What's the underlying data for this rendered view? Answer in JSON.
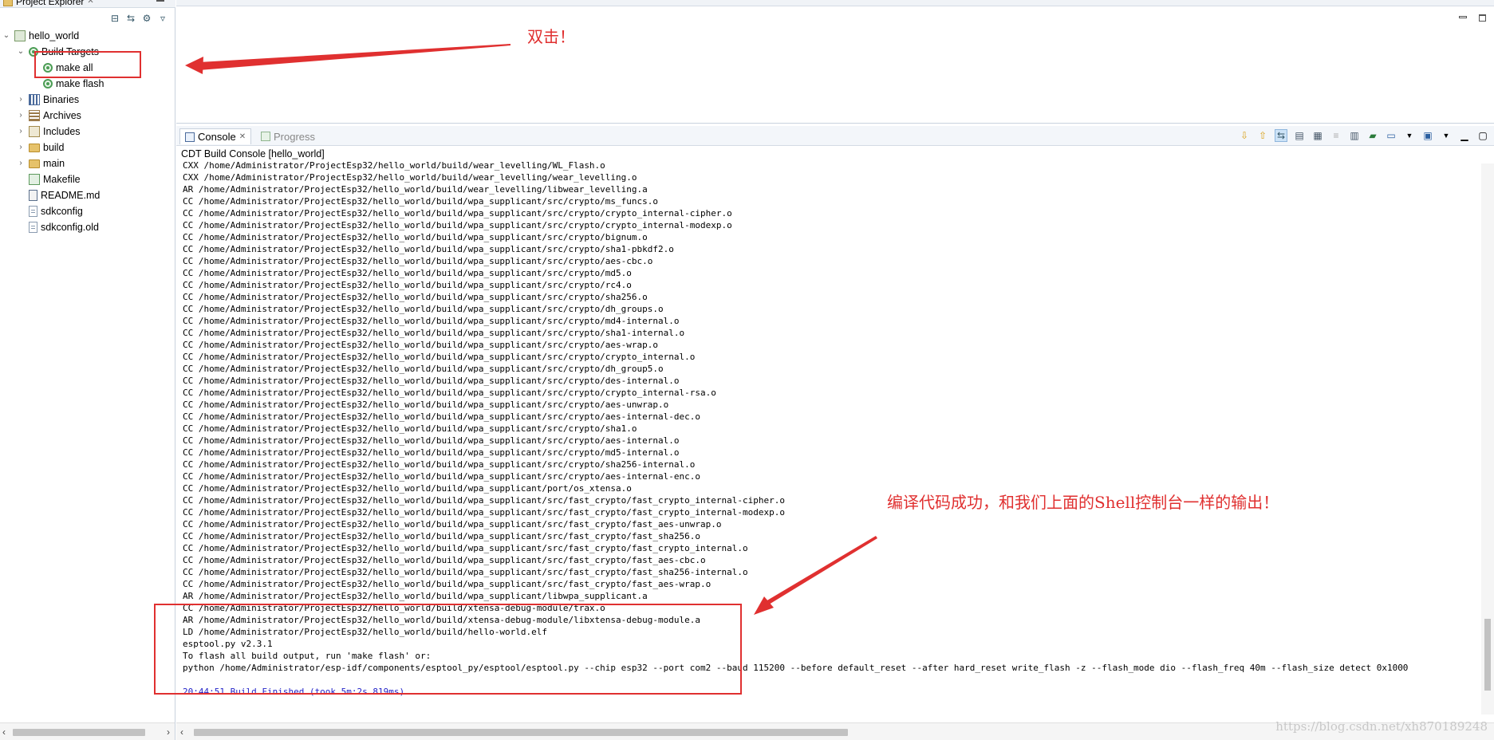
{
  "explorer": {
    "tab_title": "Project Explorer",
    "tree": [
      {
        "label": "hello_world",
        "icon": "project-icon",
        "twisty": "⌄"
      },
      {
        "label": "Build Targets",
        "icon": "build-targets-icon",
        "twisty": "⌄"
      },
      {
        "label": "make all",
        "icon": "target-icon",
        "twisty": ""
      },
      {
        "label": "make flash",
        "icon": "target-icon",
        "twisty": ""
      },
      {
        "label": "Binaries",
        "icon": "binaries-icon",
        "twisty": "›"
      },
      {
        "label": "Archives",
        "icon": "archives-icon",
        "twisty": "›"
      },
      {
        "label": "Includes",
        "icon": "includes-icon",
        "twisty": "›"
      },
      {
        "label": "build",
        "icon": "folder-icon",
        "twisty": "›"
      },
      {
        "label": "main",
        "icon": "folder-icon",
        "twisty": "›"
      },
      {
        "label": "Makefile",
        "icon": "makefile-icon",
        "twisty": ""
      },
      {
        "label": "README.md",
        "icon": "readme-icon",
        "twisty": ""
      },
      {
        "label": "sdkconfig",
        "icon": "file-icon",
        "twisty": ""
      },
      {
        "label": "sdkconfig.old",
        "icon": "file-icon",
        "twisty": ""
      }
    ]
  },
  "console": {
    "tab_console": "Console",
    "tab_progress": "Progress",
    "title": "CDT Build Console [hello_world]",
    "lines": [
      "CXX /home/Administrator/ProjectEsp32/hello_world/build/wear_levelling/WL_Flash.o",
      "CXX /home/Administrator/ProjectEsp32/hello_world/build/wear_levelling/wear_levelling.o",
      "AR /home/Administrator/ProjectEsp32/hello_world/build/wear_levelling/libwear_levelling.a",
      "CC /home/Administrator/ProjectEsp32/hello_world/build/wpa_supplicant/src/crypto/ms_funcs.o",
      "CC /home/Administrator/ProjectEsp32/hello_world/build/wpa_supplicant/src/crypto/crypto_internal-cipher.o",
      "CC /home/Administrator/ProjectEsp32/hello_world/build/wpa_supplicant/src/crypto/crypto_internal-modexp.o",
      "CC /home/Administrator/ProjectEsp32/hello_world/build/wpa_supplicant/src/crypto/bignum.o",
      "CC /home/Administrator/ProjectEsp32/hello_world/build/wpa_supplicant/src/crypto/sha1-pbkdf2.o",
      "CC /home/Administrator/ProjectEsp32/hello_world/build/wpa_supplicant/src/crypto/aes-cbc.o",
      "CC /home/Administrator/ProjectEsp32/hello_world/build/wpa_supplicant/src/crypto/md5.o",
      "CC /home/Administrator/ProjectEsp32/hello_world/build/wpa_supplicant/src/crypto/rc4.o",
      "CC /home/Administrator/ProjectEsp32/hello_world/build/wpa_supplicant/src/crypto/sha256.o",
      "CC /home/Administrator/ProjectEsp32/hello_world/build/wpa_supplicant/src/crypto/dh_groups.o",
      "CC /home/Administrator/ProjectEsp32/hello_world/build/wpa_supplicant/src/crypto/md4-internal.o",
      "CC /home/Administrator/ProjectEsp32/hello_world/build/wpa_supplicant/src/crypto/sha1-internal.o",
      "CC /home/Administrator/ProjectEsp32/hello_world/build/wpa_supplicant/src/crypto/aes-wrap.o",
      "CC /home/Administrator/ProjectEsp32/hello_world/build/wpa_supplicant/src/crypto/crypto_internal.o",
      "CC /home/Administrator/ProjectEsp32/hello_world/build/wpa_supplicant/src/crypto/dh_group5.o",
      "CC /home/Administrator/ProjectEsp32/hello_world/build/wpa_supplicant/src/crypto/des-internal.o",
      "CC /home/Administrator/ProjectEsp32/hello_world/build/wpa_supplicant/src/crypto/crypto_internal-rsa.o",
      "CC /home/Administrator/ProjectEsp32/hello_world/build/wpa_supplicant/src/crypto/aes-unwrap.o",
      "CC /home/Administrator/ProjectEsp32/hello_world/build/wpa_supplicant/src/crypto/aes-internal-dec.o",
      "CC /home/Administrator/ProjectEsp32/hello_world/build/wpa_supplicant/src/crypto/sha1.o",
      "CC /home/Administrator/ProjectEsp32/hello_world/build/wpa_supplicant/src/crypto/aes-internal.o",
      "CC /home/Administrator/ProjectEsp32/hello_world/build/wpa_supplicant/src/crypto/md5-internal.o",
      "CC /home/Administrator/ProjectEsp32/hello_world/build/wpa_supplicant/src/crypto/sha256-internal.o",
      "CC /home/Administrator/ProjectEsp32/hello_world/build/wpa_supplicant/src/crypto/aes-internal-enc.o",
      "CC /home/Administrator/ProjectEsp32/hello_world/build/wpa_supplicant/port/os_xtensa.o",
      "CC /home/Administrator/ProjectEsp32/hello_world/build/wpa_supplicant/src/fast_crypto/fast_crypto_internal-cipher.o",
      "CC /home/Administrator/ProjectEsp32/hello_world/build/wpa_supplicant/src/fast_crypto/fast_crypto_internal-modexp.o",
      "CC /home/Administrator/ProjectEsp32/hello_world/build/wpa_supplicant/src/fast_crypto/fast_aes-unwrap.o",
      "CC /home/Administrator/ProjectEsp32/hello_world/build/wpa_supplicant/src/fast_crypto/fast_sha256.o",
      "CC /home/Administrator/ProjectEsp32/hello_world/build/wpa_supplicant/src/fast_crypto/fast_crypto_internal.o",
      "CC /home/Administrator/ProjectEsp32/hello_world/build/wpa_supplicant/src/fast_crypto/fast_aes-cbc.o",
      "CC /home/Administrator/ProjectEsp32/hello_world/build/wpa_supplicant/src/fast_crypto/fast_sha256-internal.o",
      "CC /home/Administrator/ProjectEsp32/hello_world/build/wpa_supplicant/src/fast_crypto/fast_aes-wrap.o",
      "AR /home/Administrator/ProjectEsp32/hello_world/build/wpa_supplicant/libwpa_supplicant.a",
      "CC /home/Administrator/ProjectEsp32/hello_world/build/xtensa-debug-module/trax.o",
      "AR /home/Administrator/ProjectEsp32/hello_world/build/xtensa-debug-module/libxtensa-debug-module.a",
      "LD /home/Administrator/ProjectEsp32/hello_world/build/hello-world.elf",
      "esptool.py v2.3.1",
      "To flash all build output, run 'make flash' or:",
      "python /home/Administrator/esp-idf/components/esptool_py/esptool/esptool.py --chip esp32 --port com2 --baud 115200 --before default_reset --after hard_reset write_flash -z --flash_mode dio --flash_freq 40m --flash_size detect 0x1000",
      "",
      "20:44:51 Build Finished (took 5m:2s.819ms)"
    ]
  },
  "annotations": {
    "double_click": "双击！",
    "success_note": "编译代码成功，和我们上面的Shell控制台一样的输出！",
    "color": "#e03030"
  },
  "watermark": "https://blog.csdn.net/xh870189248"
}
